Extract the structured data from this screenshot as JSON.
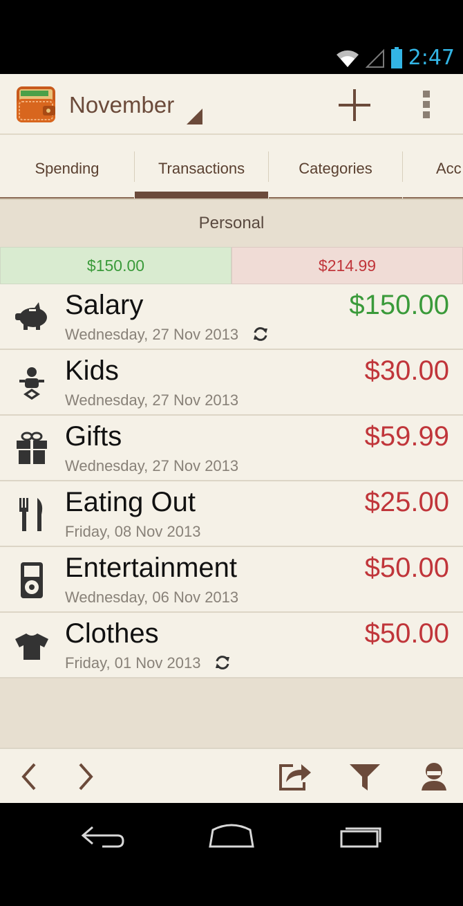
{
  "status_bar": {
    "time": "2:47",
    "icons": [
      "wifi-icon",
      "signal-icon",
      "battery-icon"
    ]
  },
  "action_bar": {
    "title": "November",
    "icons": [
      "wallet-app-logo",
      "add-icon",
      "overflow-menu-icon"
    ]
  },
  "tabs": [
    {
      "label": "Spending"
    },
    {
      "label": "Transactions",
      "active": true
    },
    {
      "label": "Categories"
    },
    {
      "label": "Acc"
    }
  ],
  "account": {
    "name": "Personal"
  },
  "summary": {
    "income": "$150.00",
    "expense": "$214.99"
  },
  "transactions": [
    {
      "category": "Salary",
      "date": "Wednesday, 27 Nov 2013",
      "amount": "$150.00",
      "type": "income",
      "icon": "piggy-bank-icon",
      "recurring": true
    },
    {
      "category": "Kids",
      "date": "Wednesday, 27 Nov 2013",
      "amount": "$30.00",
      "type": "expense",
      "icon": "baby-icon",
      "recurring": false
    },
    {
      "category": "Gifts",
      "date": "Wednesday, 27 Nov 2013",
      "amount": "$59.99",
      "type": "expense",
      "icon": "gift-icon",
      "recurring": false
    },
    {
      "category": "Eating Out",
      "date": "Friday, 08 Nov 2013",
      "amount": "$25.00",
      "type": "expense",
      "icon": "fork-knife-icon",
      "recurring": false
    },
    {
      "category": "Entertainment",
      "date": "Wednesday, 06 Nov 2013",
      "amount": "$50.00",
      "type": "expense",
      "icon": "ipod-icon",
      "recurring": false
    },
    {
      "category": "Clothes",
      "date": "Friday, 01 Nov 2013",
      "amount": "$50.00",
      "type": "expense",
      "icon": "tshirt-icon",
      "recurring": true
    }
  ],
  "bottom_bar": {
    "icons": [
      "chevron-left-icon",
      "chevron-right-icon",
      "export-icon",
      "filter-icon",
      "user-icon"
    ]
  },
  "nav_bar": {
    "icons": [
      "back-icon",
      "home-icon",
      "recents-icon"
    ]
  },
  "colors": {
    "income": "#3a9a3a",
    "expense": "#c0353a",
    "brown": "#6b4a3a",
    "background": "#f5f1e7"
  }
}
